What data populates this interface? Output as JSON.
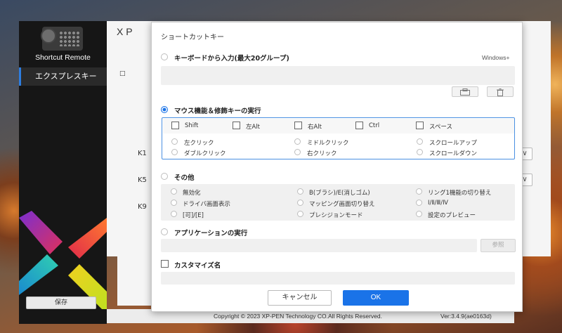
{
  "sidebar": {
    "device_name": "Shortcut Remote",
    "nav_item": "エクスプレスキー",
    "save_label": "保存"
  },
  "main": {
    "logo_text": "X P",
    "c_mark": "□",
    "keys": [
      "K1",
      "K5",
      "K9"
    ],
    "dropdown_glyph": "∨"
  },
  "footer": {
    "copyright": "Copyright © 2023  XP-PEN Technology CO.All Rights Reserved.",
    "version": "Ver:3.4.9(ae0163d)"
  },
  "dialog": {
    "title": "ショートカットキー",
    "keyboard": {
      "label": "キーボードから入力(最大20グループ)",
      "os_hint": "Windows+",
      "selected": false
    },
    "mouse": {
      "label": "マウス機能＆修飾キーの実行",
      "selected": true,
      "modifiers": [
        "Shift",
        "左Alt",
        "右Alt",
        "Ctrl",
        "スペース"
      ],
      "actions": [
        [
          "左クリック",
          "ミドルクリック",
          "スクロールアップ"
        ],
        [
          "ダブルクリック",
          "右クリック",
          "スクロールダウン"
        ]
      ]
    },
    "other": {
      "label": "その他",
      "selected": false,
      "options": [
        [
          "無効化",
          "B(ブラシ)/E(消しゴム)",
          "リング1機能の切り替え"
        ],
        [
          "ドライバ画面表示",
          "マッピング画面切り替え",
          "Ⅰ/Ⅱ/Ⅲ/Ⅳ"
        ],
        [
          "[可]/[E]",
          "プレシジョンモード",
          "設定のプレビュー"
        ]
      ]
    },
    "app": {
      "label": "アプリケーションの実行",
      "selected": false,
      "button": "参照"
    },
    "custom": {
      "label": "カスタマイズ名",
      "checked": false
    },
    "cancel_label": "キャンセル",
    "ok_label": "OK"
  },
  "colors": {
    "accent": "#1a73e8",
    "sidebar_bg": "#161616"
  }
}
